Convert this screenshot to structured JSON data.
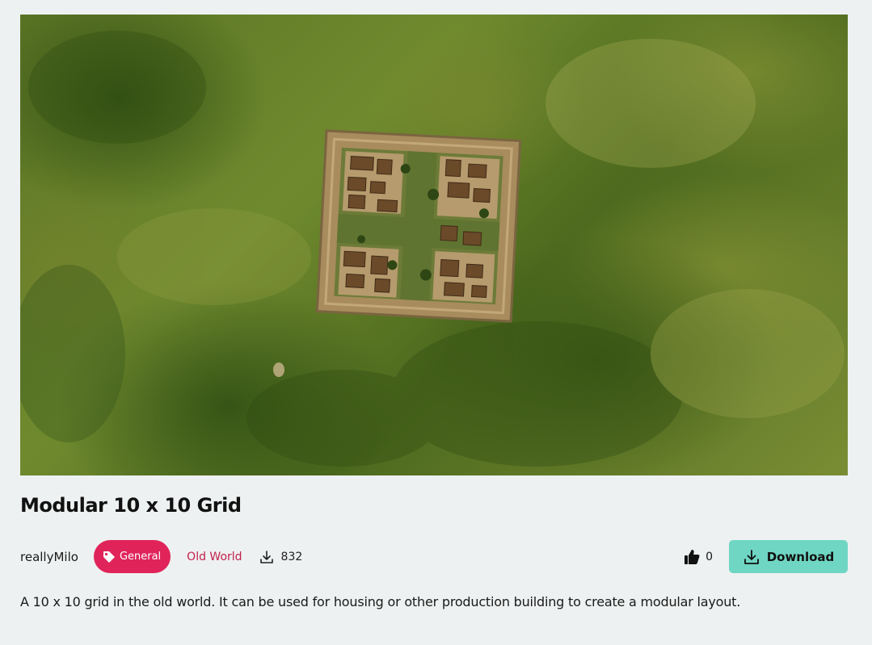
{
  "mod": {
    "image_alt": "Aerial view of a modular 10 x 10 grid settlement on grassland",
    "title": "Modular 10 x 10 Grid",
    "author": "reallyMilo",
    "tag": "General",
    "world": "Old World",
    "downloads": "832",
    "likes": "0",
    "download_label": "Download",
    "description": "A 10 x 10 grid in the old world. It can be used for housing or other production building to create a modular layout."
  },
  "colors": {
    "tag_bg": "#e0245a",
    "world_link": "#c0224e",
    "download_bg": "#6fd6c3",
    "page_bg": "#eef1f1"
  },
  "icons": {
    "tag": "tag-icon",
    "downloads": "download-icon",
    "likes": "thumbs-up-icon",
    "download_button": "download-icon"
  }
}
